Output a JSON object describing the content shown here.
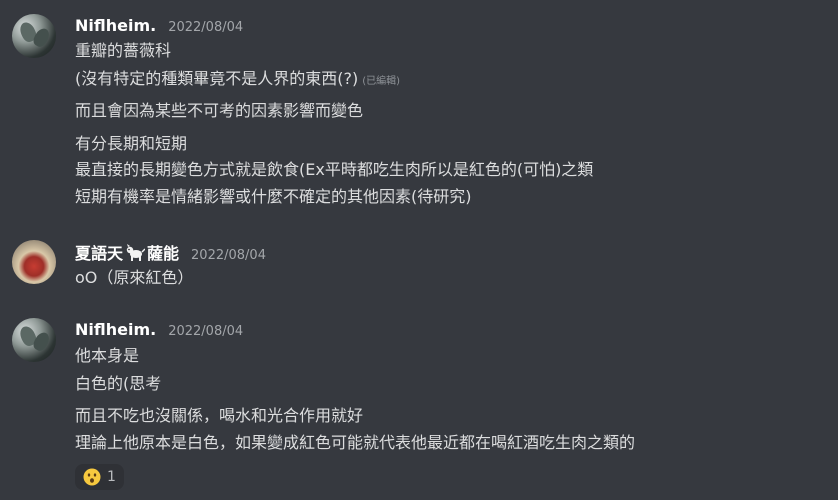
{
  "messages": [
    {
      "username": "Niflheim.",
      "timestamp": "2022/08/04",
      "lines": [
        "重瓣的薔薇科",
        "(沒有特定的種類畢竟不是人界的東西(?)",
        "而且會因為某些不可考的因素影響而變色",
        "有分長期和短期",
        "最直接的長期變色方式就是飲食(Ex平時都吃生肉所以是紅色的(可怕)之類",
        "短期有機率是情緒影響或什麼不確定的其他因素(待研究)"
      ],
      "edited_label": "(已編輯)"
    },
    {
      "username_prefix": "夏語天",
      "username_suffix": "薩能",
      "timestamp": "2022/08/04",
      "lines": [
        "oO（原來紅色）"
      ]
    },
    {
      "username": "Niflheim.",
      "timestamp": "2022/08/04",
      "lines": [
        "他本身是",
        "白色的(思考",
        "而且不吃也沒關係，喝水和光合作用就好",
        "理論上他原本是白色，如果變成紅色可能就代表他最近都在喝紅酒吃生肉之類的"
      ],
      "reaction": {
        "emoji": "hushed-face",
        "count": "1"
      }
    }
  ],
  "colors": {
    "background": "#36393f",
    "username": "#ffffff",
    "text": "#dcddde",
    "timestamp": "#a3a6aa",
    "reaction_bg": "#2f3136"
  }
}
